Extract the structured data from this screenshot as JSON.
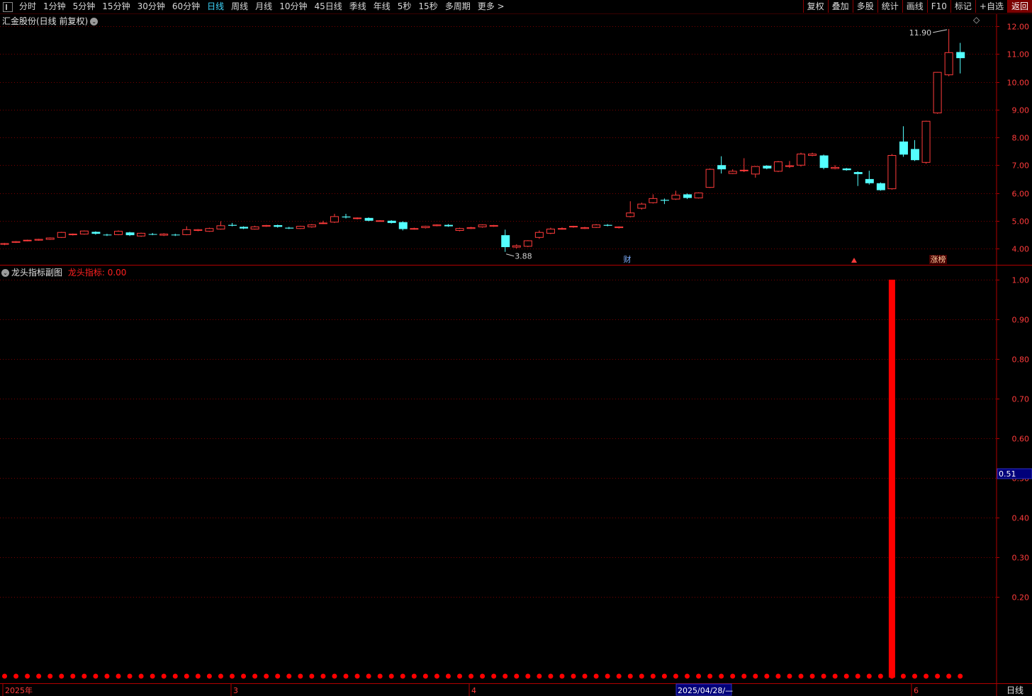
{
  "toolbar": {
    "periods": [
      "分时",
      "1分钟",
      "5分钟",
      "15分钟",
      "30分钟",
      "60分钟",
      "日线",
      "周线",
      "月线",
      "10分钟",
      "45日线",
      "季线",
      "年线",
      "5秒",
      "15秒",
      "多周期",
      "更多 >"
    ],
    "active": "日线",
    "right_buttons": [
      "复权",
      "叠加",
      "多股",
      "统计",
      "画线",
      "F10",
      "标记",
      "+自选",
      "返回"
    ]
  },
  "main": {
    "title": "汇金股份(日线 前复权)",
    "y_ticks": [
      "12.00",
      "11.00",
      "10.00",
      "9.00",
      "8.00",
      "7.00",
      "6.00",
      "5.00",
      "4.00"
    ],
    "high_label": "11.90",
    "low_label": "3.88",
    "markers": {
      "cai": "财",
      "zhangbang": "涨榜"
    }
  },
  "sub": {
    "title": "龙头指标副图",
    "indicator_label": "龙头指标: 0.00",
    "y_ticks": [
      "1.00",
      "0.90",
      "0.80",
      "0.70",
      "0.60",
      "0.50",
      "0.40",
      "0.30",
      "0.20"
    ],
    "cursor_value": "0.51"
  },
  "bottom": {
    "dates": [
      "2025年",
      "3",
      "4",
      "6"
    ],
    "cursor_date": "2025/04/28/—",
    "period_label": "日线"
  },
  "colors": {
    "up": "#ff3b3b",
    "down": "#54ffff",
    "grid": "#7a0000",
    "border": "#b00000",
    "bar": "#ff0000"
  },
  "chart_data": {
    "type": "candlestick",
    "ylim": [
      3.6,
      12.4
    ],
    "sub_ylim": [
      0,
      1.05
    ],
    "candles": [
      [
        4.15,
        4.18,
        4.12,
        4.2
      ],
      [
        4.22,
        4.25,
        4.2,
        4.27
      ],
      [
        4.28,
        4.3,
        4.26,
        4.32
      ],
      [
        4.3,
        4.33,
        4.28,
        4.35
      ],
      [
        4.33,
        4.38,
        4.31,
        4.4
      ],
      [
        4.4,
        4.58,
        4.38,
        4.6
      ],
      [
        4.5,
        4.52,
        4.47,
        4.54
      ],
      [
        4.52,
        4.63,
        4.5,
        4.65
      ],
      [
        4.6,
        4.53,
        4.5,
        4.62
      ],
      [
        4.5,
        4.48,
        4.45,
        4.53
      ],
      [
        4.5,
        4.62,
        4.48,
        4.65
      ],
      [
        4.58,
        4.48,
        4.45,
        4.6
      ],
      [
        4.45,
        4.55,
        4.42,
        4.57
      ],
      [
        4.52,
        4.5,
        4.48,
        4.56
      ],
      [
        4.48,
        4.52,
        4.45,
        4.55
      ],
      [
        4.5,
        4.48,
        4.45,
        4.53
      ],
      [
        4.5,
        4.68,
        4.48,
        4.8
      ],
      [
        4.65,
        4.68,
        4.62,
        4.7
      ],
      [
        4.62,
        4.72,
        4.6,
        4.75
      ],
      [
        4.7,
        4.82,
        4.68,
        4.98
      ],
      [
        4.85,
        4.82,
        4.8,
        4.92
      ],
      [
        4.78,
        4.72,
        4.7,
        4.8
      ],
      [
        4.7,
        4.78,
        4.68,
        4.82
      ],
      [
        4.8,
        4.83,
        4.78,
        4.85
      ],
      [
        4.84,
        4.78,
        4.75,
        4.86
      ],
      [
        4.75,
        4.72,
        4.7,
        4.78
      ],
      [
        4.72,
        4.8,
        4.7,
        4.82
      ],
      [
        4.78,
        4.85,
        4.75,
        4.88
      ],
      [
        4.9,
        4.92,
        4.88,
        5.0
      ],
      [
        4.95,
        5.15,
        4.92,
        5.25
      ],
      [
        5.15,
        5.12,
        5.08,
        5.25
      ],
      [
        5.1,
        5.1,
        5.05,
        5.12
      ],
      [
        5.1,
        5.0,
        4.98,
        5.12
      ],
      [
        5.0,
        5.0,
        4.98,
        5.02
      ],
      [
        5.0,
        4.92,
        4.9,
        5.02
      ],
      [
        4.95,
        4.7,
        4.65,
        4.98
      ],
      [
        4.7,
        4.72,
        4.68,
        4.75
      ],
      [
        4.75,
        4.8,
        4.72,
        4.82
      ],
      [
        4.82,
        4.85,
        4.8,
        4.87
      ],
      [
        4.85,
        4.8,
        4.78,
        4.88
      ],
      [
        4.65,
        4.72,
        4.62,
        4.75
      ],
      [
        4.72,
        4.75,
        4.7,
        4.78
      ],
      [
        4.78,
        4.85,
        4.75,
        4.87
      ],
      [
        4.8,
        4.83,
        4.78,
        4.85
      ],
      [
        4.48,
        4.05,
        3.88,
        4.68
      ],
      [
        4.05,
        4.1,
        4.0,
        4.15
      ],
      [
        4.08,
        4.28,
        4.05,
        4.3
      ],
      [
        4.4,
        4.58,
        4.35,
        4.65
      ],
      [
        4.55,
        4.7,
        4.52,
        4.75
      ],
      [
        4.7,
        4.72,
        4.68,
        4.76
      ],
      [
        4.78,
        4.8,
        4.75,
        4.82
      ],
      [
        4.72,
        4.75,
        4.7,
        4.78
      ],
      [
        4.76,
        4.85,
        4.74,
        4.88
      ],
      [
        4.85,
        4.82,
        4.8,
        4.88
      ],
      [
        4.75,
        4.78,
        4.72,
        4.8
      ],
      [
        5.15,
        5.28,
        5.12,
        5.7
      ],
      [
        5.45,
        5.6,
        5.4,
        5.65
      ],
      [
        5.65,
        5.8,
        5.62,
        5.95
      ],
      [
        5.75,
        5.72,
        5.6,
        5.8
      ],
      [
        5.78,
        5.92,
        5.75,
        6.08
      ],
      [
        5.95,
        5.82,
        5.78,
        5.98
      ],
      [
        5.82,
        6.0,
        5.8,
        6.02
      ],
      [
        6.2,
        6.85,
        6.18,
        6.88
      ],
      [
        7.0,
        6.85,
        6.7,
        7.32
      ],
      [
        6.7,
        6.78,
        6.68,
        6.85
      ],
      [
        6.8,
        6.82,
        6.75,
        7.25
      ],
      [
        6.68,
        6.95,
        6.55,
        6.97
      ],
      [
        6.98,
        6.88,
        6.85,
        7.0
      ],
      [
        6.78,
        7.12,
        6.75,
        7.15
      ],
      [
        6.95,
        6.98,
        6.9,
        7.15
      ],
      [
        7.0,
        7.4,
        6.95,
        7.45
      ],
      [
        7.35,
        7.4,
        7.32,
        7.45
      ],
      [
        7.35,
        6.9,
        6.85,
        7.38
      ],
      [
        6.88,
        6.92,
        6.85,
        7.0
      ],
      [
        6.88,
        6.82,
        6.8,
        6.9
      ],
      [
        6.75,
        6.68,
        6.25,
        6.78
      ],
      [
        6.5,
        6.35,
        6.3,
        6.8
      ],
      [
        6.35,
        6.1,
        6.08,
        6.38
      ],
      [
        6.15,
        7.35,
        6.12,
        7.4
      ],
      [
        7.85,
        7.38,
        7.3,
        8.4
      ],
      [
        7.58,
        7.18,
        7.15,
        7.9
      ],
      [
        7.1,
        8.58,
        7.05,
        8.6
      ],
      [
        8.88,
        10.34,
        8.85,
        10.35
      ],
      [
        10.25,
        11.05,
        10.2,
        11.9
      ],
      [
        11.07,
        10.85,
        10.3,
        11.4
      ]
    ],
    "signal_bar_index": 78,
    "signal_bar_value": 1.0
  }
}
